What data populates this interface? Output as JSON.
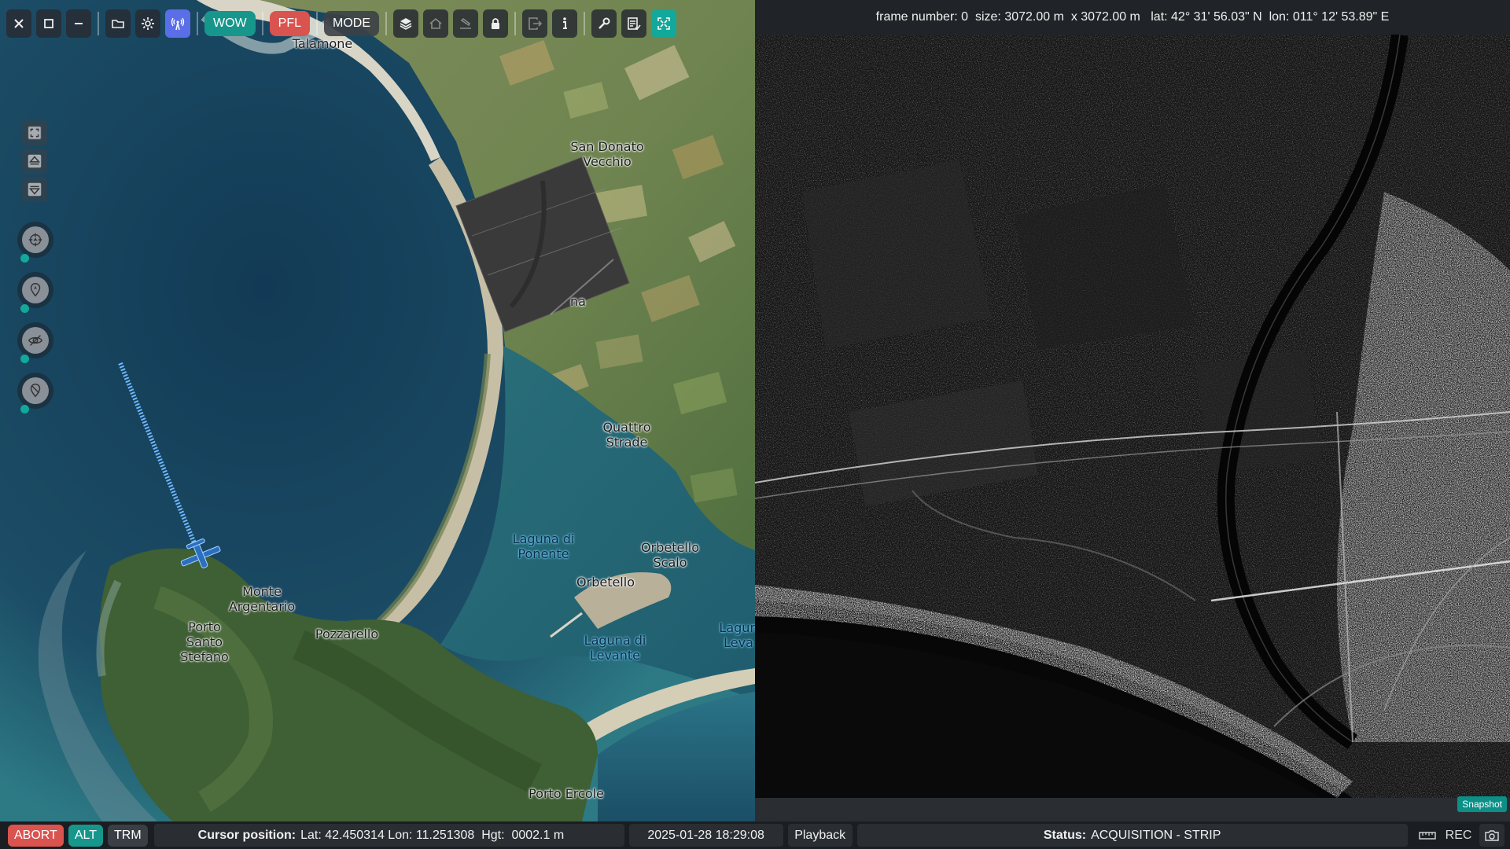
{
  "toolbar": {
    "close_icon": "close-icon",
    "maximize_icon": "maximize-icon",
    "minimize_icon": "minimize-icon",
    "wow_label": "WOW",
    "pfl_label": "PFL",
    "mode_label": "MODE",
    "colors": {
      "wow": "#17968c",
      "pfl": "#d9534f",
      "link_active": "#5a6ee8",
      "fullscreen": "#12a89a"
    }
  },
  "map": {
    "places": [
      {
        "name": "Talamone"
      },
      {
        "name": "San Donato\nVecchio"
      },
      {
        "name": "Quattro\nStrade"
      },
      {
        "name": "Orbetello\nScalo"
      },
      {
        "name": "Orbetello"
      },
      {
        "name": "Monte\nArgentario"
      },
      {
        "name": "Porto\nSanto\nStefano"
      },
      {
        "name": "Pozzarello"
      },
      {
        "name": "Porto Ercole"
      },
      {
        "name": "na"
      }
    ],
    "water": [
      {
        "name": "Laguna di\nPonente"
      },
      {
        "name": "Laguna di\nLevante"
      },
      {
        "name": "Lagun\nLeva"
      }
    ]
  },
  "sar": {
    "frame_label": "frame number:",
    "frame_value": "0",
    "size_label": "size:",
    "size_value": "3072.00 m  x 3072.00 m",
    "lat_label": "lat:",
    "lat_value": "42° 31' 56.03\" N",
    "lon_label": "lon:",
    "lon_value": "011° 12' 53.89\" E",
    "snapshot_label": "Snapshot"
  },
  "status_bar": {
    "abort_label": "ABORT",
    "alt_label": "ALT",
    "trm_label": "TRM",
    "cursor_label": "Cursor position:",
    "cursor_lat": "Lat: 42.450314",
    "cursor_lon": "Lon: 11.251308",
    "cursor_hgt": "Hgt:  0002.1 m",
    "datetime": "2025-01-28 18:29:08",
    "playback_label": "Playback",
    "status_label": "Status:",
    "status_value": "ACQUISITION - STRIP",
    "rec_label": "REC",
    "colors": {
      "abort": "#d9534f",
      "alt": "#17968c"
    }
  }
}
